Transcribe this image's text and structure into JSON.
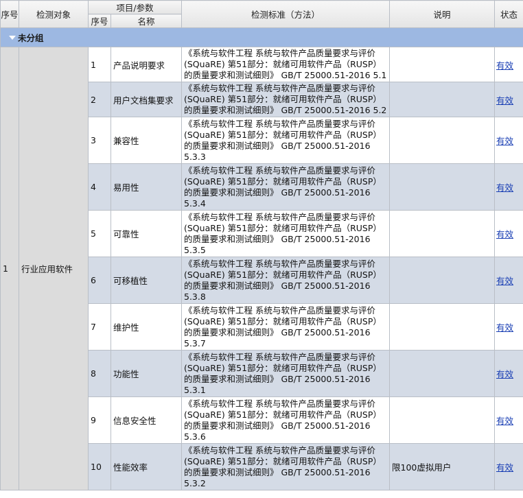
{
  "header": {
    "seq": "序号",
    "object": "检测对象",
    "item_param": "项目/参数",
    "item_seq": "序号",
    "item_name": "名称",
    "standard": "检测标准（方法）",
    "remark": "说明",
    "status": "状态"
  },
  "group": {
    "label": "未分组"
  },
  "object_row": {
    "seq": "1",
    "name": "行业应用软件"
  },
  "items": [
    {
      "no": "1",
      "name": "产品说明要求",
      "standard": "《系统与软件工程 系统与软件产品质量要求与评价(SQuaRE) 第51部分：就绪可用软件产品（RUSP）的质量要求和测试细则》 GB/T 25000.51-2016 5.1",
      "remark": "",
      "status": "有效"
    },
    {
      "no": "2",
      "name": "用户文档集要求",
      "standard": "《系统与软件工程 系统与软件产品质量要求与评价(SQuaRE) 第51部分：就绪可用软件产品（RUSP）的质量要求和测试细则》 GB/T 25000.51-2016 5.2",
      "remark": "",
      "status": "有效"
    },
    {
      "no": "3",
      "name": "兼容性",
      "standard": "《系统与软件工程 系统与软件产品质量要求与评价(SQuaRE) 第51部分：就绪可用软件产品（RUSP）的质量要求和测试细则》 GB/T 25000.51-2016 5.3.3",
      "remark": "",
      "status": "有效"
    },
    {
      "no": "4",
      "name": "易用性",
      "standard": "《系统与软件工程 系统与软件产品质量要求与评价(SQuaRE) 第51部分：就绪可用软件产品（RUSP）的质量要求和测试细则》 GB/T 25000.51-2016 5.3.4",
      "remark": "",
      "status": "有效"
    },
    {
      "no": "5",
      "name": "可靠性",
      "standard": "《系统与软件工程 系统与软件产品质量要求与评价(SQuaRE) 第51部分：就绪可用软件产品（RUSP）的质量要求和测试细则》 GB/T 25000.51-2016 5.3.5",
      "remark": "",
      "status": "有效"
    },
    {
      "no": "6",
      "name": "可移植性",
      "standard": "《系统与软件工程 系统与软件产品质量要求与评价(SQuaRE) 第51部分：就绪可用软件产品（RUSP）的质量要求和测试细则》 GB/T 25000.51-2016 5.3.8",
      "remark": "",
      "status": "有效"
    },
    {
      "no": "7",
      "name": "维护性",
      "standard": "《系统与软件工程 系统与软件产品质量要求与评价(SQuaRE) 第51部分：就绪可用软件产品（RUSP）的质量要求和测试细则》 GB/T 25000.51-2016 5.3.7",
      "remark": "",
      "status": "有效"
    },
    {
      "no": "8",
      "name": "功能性",
      "standard": "《系统与软件工程 系统与软件产品质量要求与评价(SQuaRE) 第51部分：就绪可用软件产品（RUSP）的质量要求和测试细则》 GB/T 25000.51-2016 5.3.1",
      "remark": "",
      "status": "有效"
    },
    {
      "no": "9",
      "name": "信息安全性",
      "standard": "《系统与软件工程 系统与软件产品质量要求与评价(SQuaRE) 第51部分：就绪可用软件产品（RUSP）的质量要求和测试细则》 GB/T 25000.51-2016 5.3.6",
      "remark": "",
      "status": "有效"
    },
    {
      "no": "10",
      "name": "性能效率",
      "standard": "《系统与软件工程 系统与软件产品质量要求与评价(SQuaRE) 第51部分：就绪可用软件产品（RUSP）的质量要求和测试细则》 GB/T 25000.51-2016 5.3.2",
      "remark": "限100虚拟用户",
      "status": "有效"
    }
  ]
}
